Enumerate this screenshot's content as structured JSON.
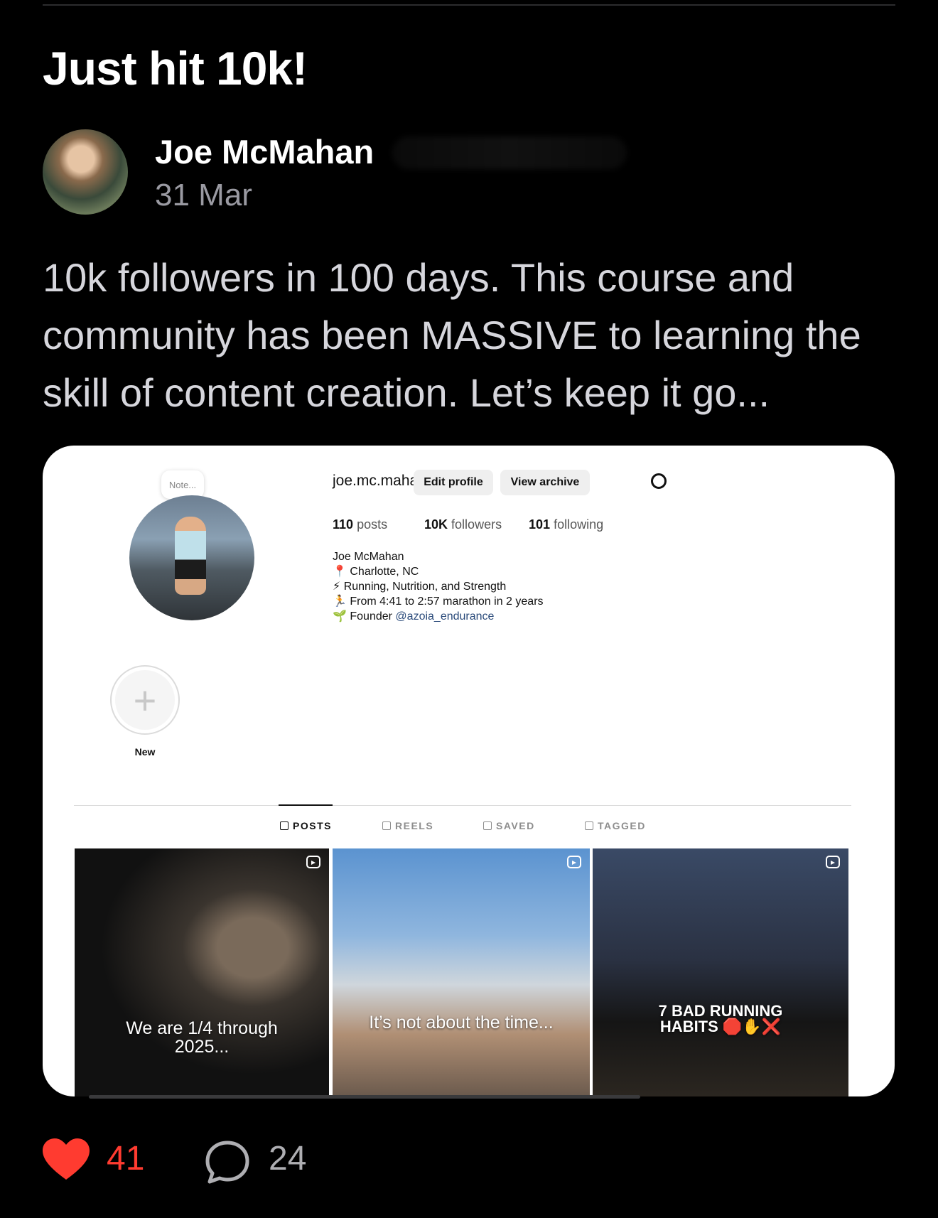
{
  "post": {
    "title": "Just hit 10k!",
    "author": "Joe McMahan",
    "date": "31 Mar",
    "body": "10k followers in 100 days. This course and community has been MASSIVE to learning the skill of content creation. Let’s keep it go...",
    "likes": "41",
    "comments": "24"
  },
  "screenshot": {
    "note": "Note...",
    "username": "joe.mc.mahan",
    "edit_profile": "Edit profile",
    "view_archive": "View archive",
    "stats": {
      "posts_num": "110",
      "posts_label": "posts",
      "followers_num": "10K",
      "followers_label": "followers",
      "following_num": "101",
      "following_label": "following"
    },
    "bio": {
      "name": "Joe McMahan",
      "line1_emoji": "📍",
      "line1": "Charlotte, NC",
      "line2_emoji": "⚡",
      "line2": "Running, Nutrition, and Strength",
      "line3_emoji": "🏃",
      "line3": "From 4:41 to 2:57 marathon in 2 years",
      "line4_emoji": "🌱",
      "line4_prefix": "Founder",
      "line4_link": "@azoia_endurance"
    },
    "new_highlight": "New",
    "tabs": [
      "POSTS",
      "REELS",
      "SAVED",
      "TAGGED"
    ],
    "tiles": [
      {
        "caption": "We are 1/4 through 2025..."
      },
      {
        "caption": "It’s not about the time..."
      },
      {
        "caption": "7 BAD RUNNING HABITS 🛑✋❌"
      }
    ]
  },
  "icons": [
    "heart-icon",
    "comment-icon",
    "reel-icon",
    "settings-icon",
    "plus-icon"
  ],
  "colors": {
    "background": "#000000",
    "like": "#ff3b30",
    "muted": "#9a9aa2"
  }
}
